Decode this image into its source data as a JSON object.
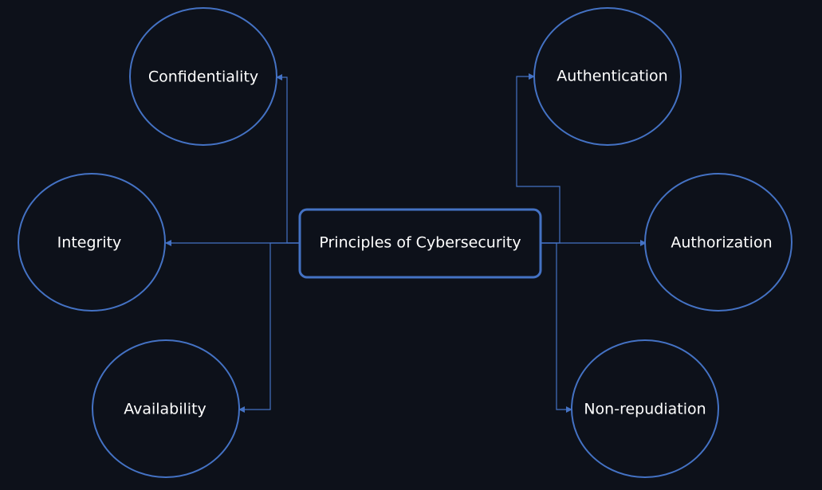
{
  "diagram": {
    "center": "Principles of Cybersecurity",
    "left_nodes": {
      "confidentiality": "Confidentiality",
      "integrity": "Integrity",
      "availability": "Availability"
    },
    "right_nodes": {
      "authentication": "Authentication",
      "authorization": "Authorization",
      "non_repudiation": "Non-repudiation"
    }
  },
  "colors": {
    "background": "#0d111a",
    "accent": "#4472c4",
    "text": "#ffffff"
  }
}
